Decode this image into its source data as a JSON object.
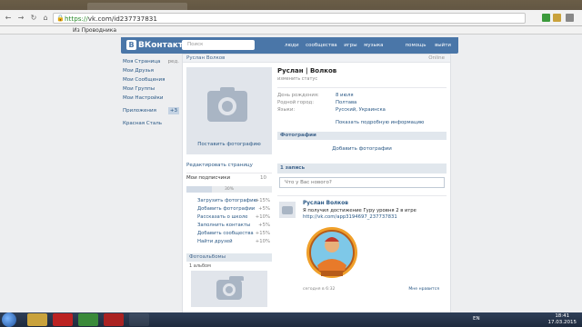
{
  "browser": {
    "url_scheme": "https://",
    "url_rest": "vk.com/id237737831",
    "bookmark": "Из Проводника"
  },
  "header": {
    "logo": "ВКонтакте",
    "logo_letter": "В",
    "search_placeholder": "Поиск",
    "nav": [
      "люди",
      "сообщества",
      "игры",
      "музыка"
    ],
    "right": [
      "помощь",
      "выйти"
    ]
  },
  "sidebar": {
    "items": [
      {
        "label": "Моя Страница",
        "extra": "ред."
      },
      {
        "label": "Мои Друзья"
      },
      {
        "label": "Мои Сообщения"
      },
      {
        "label": "Мои Группы"
      },
      {
        "label": "Мои Настройки"
      },
      {
        "label": "Приложения",
        "count": "+3"
      },
      {
        "label": "Красная Сталь"
      }
    ]
  },
  "profile": {
    "page_title": "Руслан Волков",
    "page_title_right": "Online",
    "name": "Руслан | Волков",
    "status_prompt": "изменить статус",
    "info": [
      {
        "key": "День рождения:",
        "value": "8 июля"
      },
      {
        "key": "Родной город:",
        "value": "Полтава"
      },
      {
        "key": "Языки:",
        "value": "Русский, Украинска"
      }
    ],
    "show_more": "Показать подробную информацию",
    "avatar_caption": "Поставить фотографию",
    "edit_page": "Редактировать страницу",
    "subscribers_label": "Мои подписчики",
    "subscribers_count": "10",
    "progress_label": "30%",
    "progress_value": 0.3,
    "tasks": [
      {
        "label": "Загрузить фотографию",
        "pct": "+15%"
      },
      {
        "label": "Добавить фотографии",
        "pct": "+5%"
      },
      {
        "label": "Рассказать о школе",
        "pct": "+10%"
      },
      {
        "label": "Заполнить контакты",
        "pct": "+5%"
      },
      {
        "label": "Добавить сообщества",
        "pct": "+15%"
      },
      {
        "label": "Найти друзей",
        "pct": "+10%"
      }
    ],
    "albums_title": "Фотоальбомы",
    "albums_count": "1 альбом",
    "photos_title": "Фотографии",
    "add_photos": "Добавить фотографии",
    "wall_title": "1 запись",
    "wall_placeholder": "Что у Вас нового?"
  },
  "post": {
    "author": "Руслан Волков",
    "text": "Я получил достижение Гуру уровня 2 в игре",
    "link": "http://vk.com/app3194697_237737831",
    "date": "сегодня в 6:32",
    "like": "Мне нравится"
  },
  "taskbar": {
    "lang": "EN",
    "time": "18:41",
    "date": "17.03.2015"
  },
  "colors": {
    "vk_blue": "#4a76a8",
    "link": "#2a5885",
    "page_bg": "#edeef0"
  }
}
